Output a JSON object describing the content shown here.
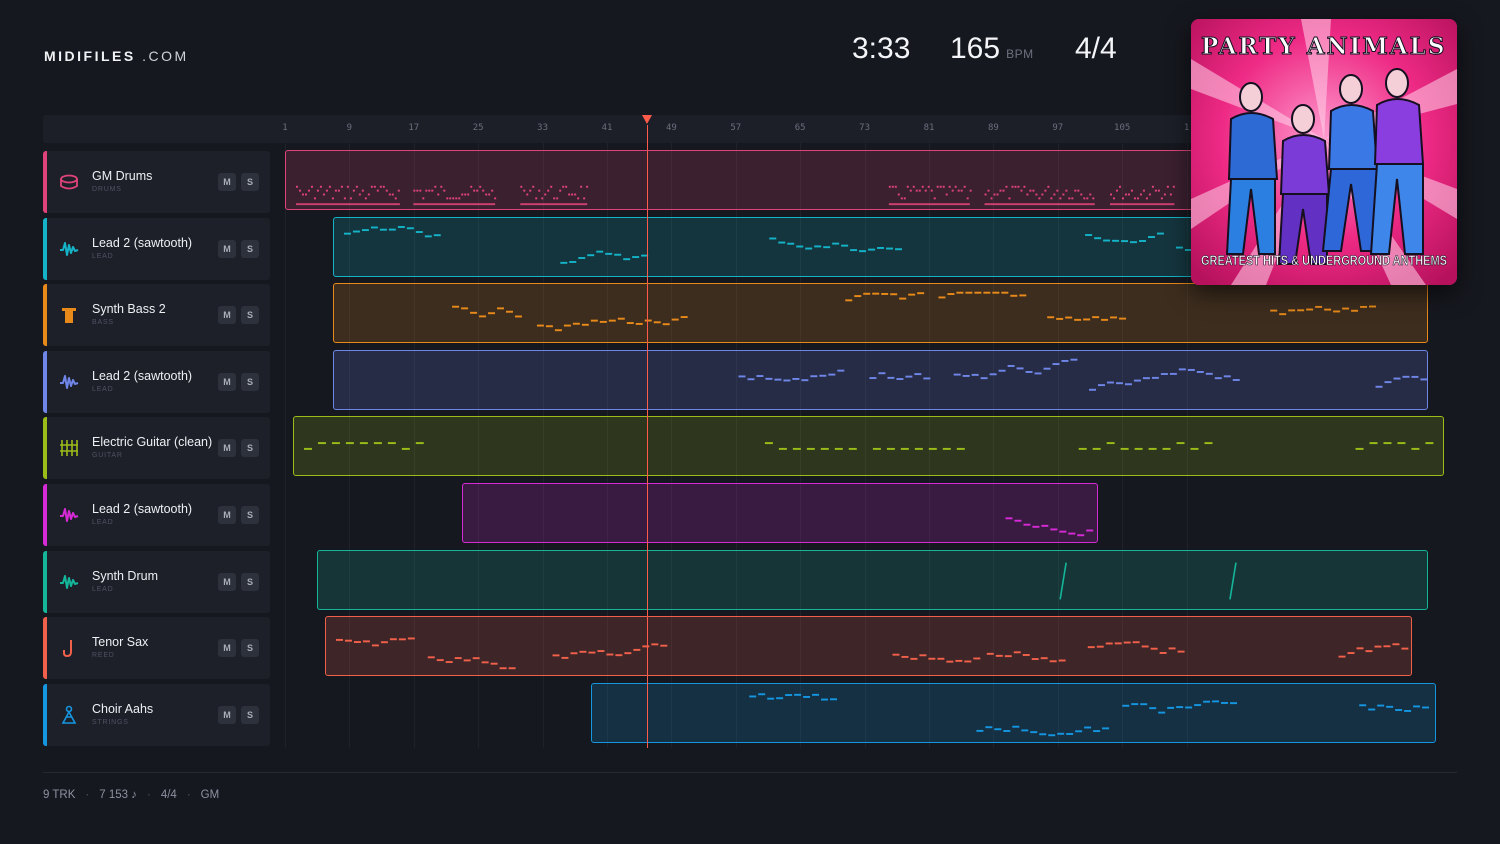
{
  "brand": {
    "bold": "MIDIFILES",
    "rest": ".COM"
  },
  "stats": {
    "duration": "3:33",
    "tempo": "165",
    "tempo_unit": "BPM",
    "time_signature": "4/4"
  },
  "ruler": {
    "ticks": [
      "1",
      "9",
      "17",
      "25",
      "33",
      "41",
      "49",
      "57",
      "65",
      "73",
      "81",
      "89",
      "97",
      "105",
      "1"
    ]
  },
  "playhead_bar": 46,
  "tracks": [
    {
      "name": "GM Drums",
      "category": "DRUMS",
      "color": "#e0437a",
      "icon": "drum-icon",
      "mute": "M",
      "solo": "S",
      "region": [
        1,
        124
      ],
      "style": "drums"
    },
    {
      "name": "Lead 2 (sawtooth)",
      "category": "LEAD",
      "color": "#14b3c7",
      "icon": "wave-icon",
      "mute": "M",
      "solo": "S",
      "region": [
        7,
        124
      ],
      "style": "lead"
    },
    {
      "name": "Synth Bass 2",
      "category": "BASS",
      "color": "#e88a1a",
      "icon": "bass-icon",
      "mute": "M",
      "solo": "S",
      "region": [
        7,
        143
      ],
      "style": "bass"
    },
    {
      "name": "Lead 2 (sawtooth)",
      "category": "LEAD",
      "color": "#6f86e8",
      "icon": "wave-icon",
      "mute": "M",
      "solo": "S",
      "region": [
        7,
        143
      ],
      "style": "lead"
    },
    {
      "name": "Electric Guitar (clean)",
      "category": "GUITAR",
      "color": "#9bbd18",
      "icon": "guitar-icon",
      "mute": "M",
      "solo": "S",
      "region": [
        2,
        145
      ],
      "style": "guitar"
    },
    {
      "name": "Lead 2 (sawtooth)",
      "category": "LEAD",
      "color": "#d62ad6",
      "icon": "wave-icon",
      "mute": "M",
      "solo": "S",
      "region": [
        23,
        102
      ],
      "style": "lead"
    },
    {
      "name": "Synth Drum",
      "category": "LEAD",
      "color": "#15b59a",
      "icon": "wave-icon",
      "mute": "M",
      "solo": "S",
      "region": [
        5,
        143
      ],
      "style": "synthdrum"
    },
    {
      "name": "Tenor Sax",
      "category": "REED",
      "color": "#f0604a",
      "icon": "sax-icon",
      "mute": "M",
      "solo": "S",
      "region": [
        6,
        141
      ],
      "style": "sax"
    },
    {
      "name": "Choir Aahs",
      "category": "STRINGS",
      "color": "#1596e0",
      "icon": "choir-icon",
      "mute": "M",
      "solo": "S",
      "region": [
        39,
        144
      ],
      "style": "choir"
    }
  ],
  "cover": {
    "title": "PARTY ANIMALS",
    "subtitle": "GREATEST HITS & UNDERGROUND ANTHEMS"
  },
  "footer": {
    "tracks": "9 TRK",
    "notes": "7 153 ♪",
    "meter": "4/4",
    "standard": "GM"
  }
}
